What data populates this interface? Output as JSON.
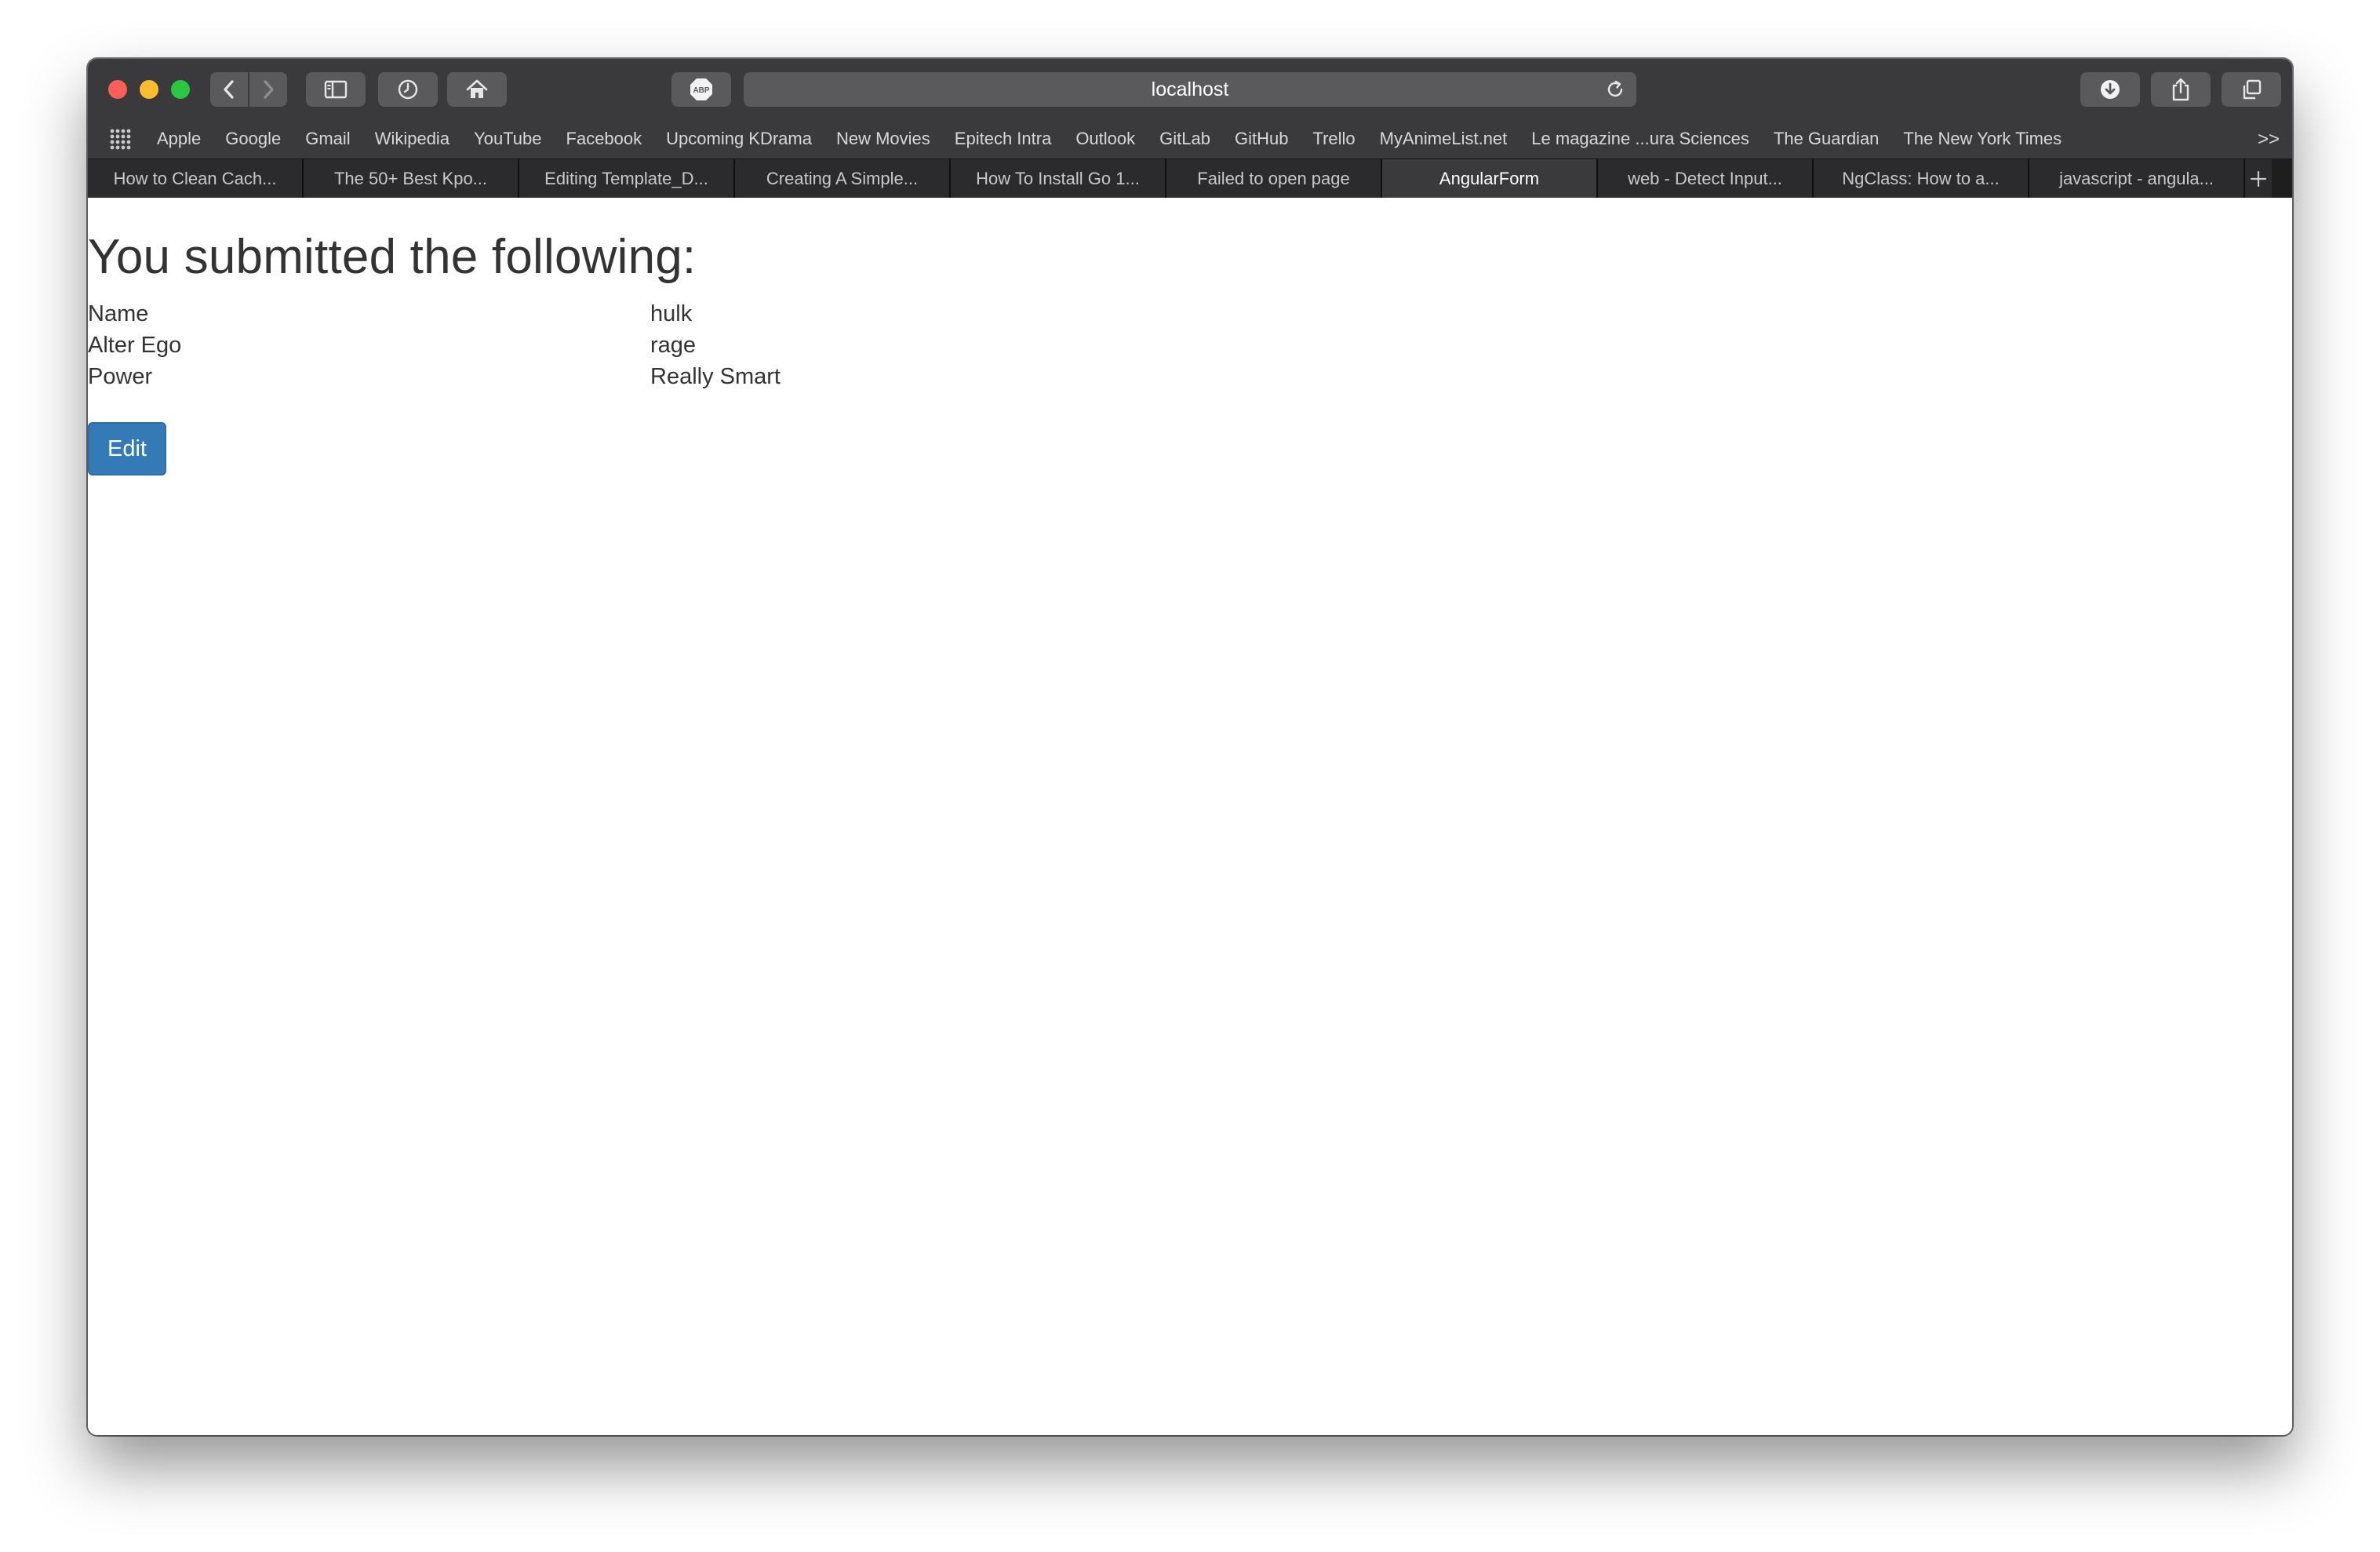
{
  "browser": {
    "address": "localhost",
    "abp_label": "ABP",
    "more_bookmarks": ">>",
    "bookmarks": [
      "Apple",
      "Google",
      "Gmail",
      "Wikipedia",
      "YouTube",
      "Facebook",
      "Upcoming KDrama",
      "New Movies",
      "Epitech Intra",
      "Outlook",
      "GitLab",
      "GitHub",
      "Trello",
      "MyAnimeList.net",
      "Le magazine ...ura Sciences",
      "The Guardian",
      "The New York Times"
    ],
    "tabs": [
      "How to Clean Cach...",
      "The 50+ Best Kpo...",
      "Editing Template_D...",
      "Creating A Simple...",
      "How To Install Go 1...",
      "Failed to open page",
      "AngularForm",
      "web - Detect Input...",
      "NgClass: How to a...",
      "javascript - angula..."
    ],
    "active_tab": "AngularForm"
  },
  "page": {
    "title": "You submitted the following:",
    "rows": [
      {
        "label": "Name",
        "value": "hulk"
      },
      {
        "label": "Alter Ego",
        "value": "rage"
      },
      {
        "label": "Power",
        "value": "Really Smart"
      }
    ],
    "edit_label": "Edit"
  },
  "colors": {
    "primary_button": "#337ab7",
    "toolbar": "#3a3a3c",
    "tabbar": "#1e1e1f",
    "text": "#333333"
  }
}
